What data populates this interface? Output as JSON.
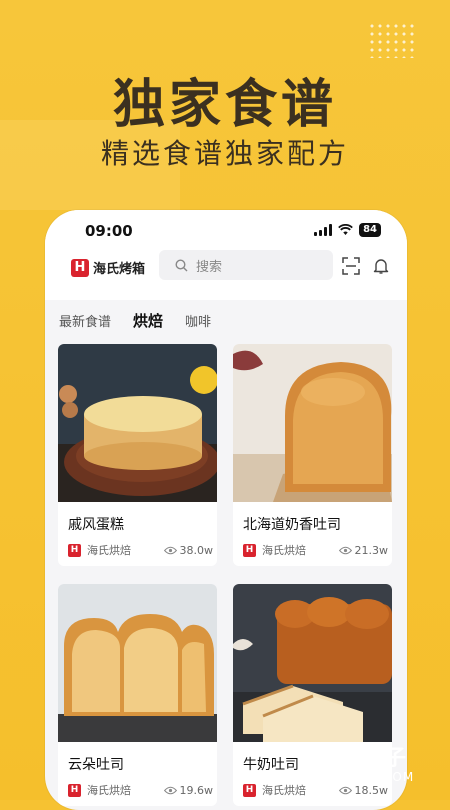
{
  "promo": {
    "headline": "独家食谱",
    "subheadline": "精选食谱独家配方"
  },
  "status_bar": {
    "time": "09:00",
    "battery": "84"
  },
  "app": {
    "logo_mark": "H",
    "logo_text": "海氏烤箱",
    "search_placeholder": "搜索"
  },
  "tabs": [
    {
      "label": "最新食谱",
      "active": false
    },
    {
      "label": "烘焙",
      "active": true
    },
    {
      "label": "咖啡",
      "active": false
    }
  ],
  "recipes": [
    {
      "title": "戚风蛋糕",
      "author": "海氏烘焙",
      "views": "38.0w"
    },
    {
      "title": "北海道奶香吐司",
      "author": "海氏烘焙",
      "views": "21.3w"
    },
    {
      "title": "云朵吐司",
      "author": "海氏烘焙",
      "views": "19.6w"
    },
    {
      "title": "牛奶吐司",
      "author": "海氏烘焙",
      "views": "18.5w"
    }
  ],
  "watermark": {
    "brand": "七叶子",
    "url": "7YZ.COM"
  },
  "colors": {
    "background": "#f6c232",
    "brand_red": "#d9232e",
    "headline": "#3b3020"
  },
  "icons": [
    "search-icon",
    "scan-icon",
    "bell-icon",
    "eye-icon",
    "wifi-icon",
    "signal-icon"
  ]
}
